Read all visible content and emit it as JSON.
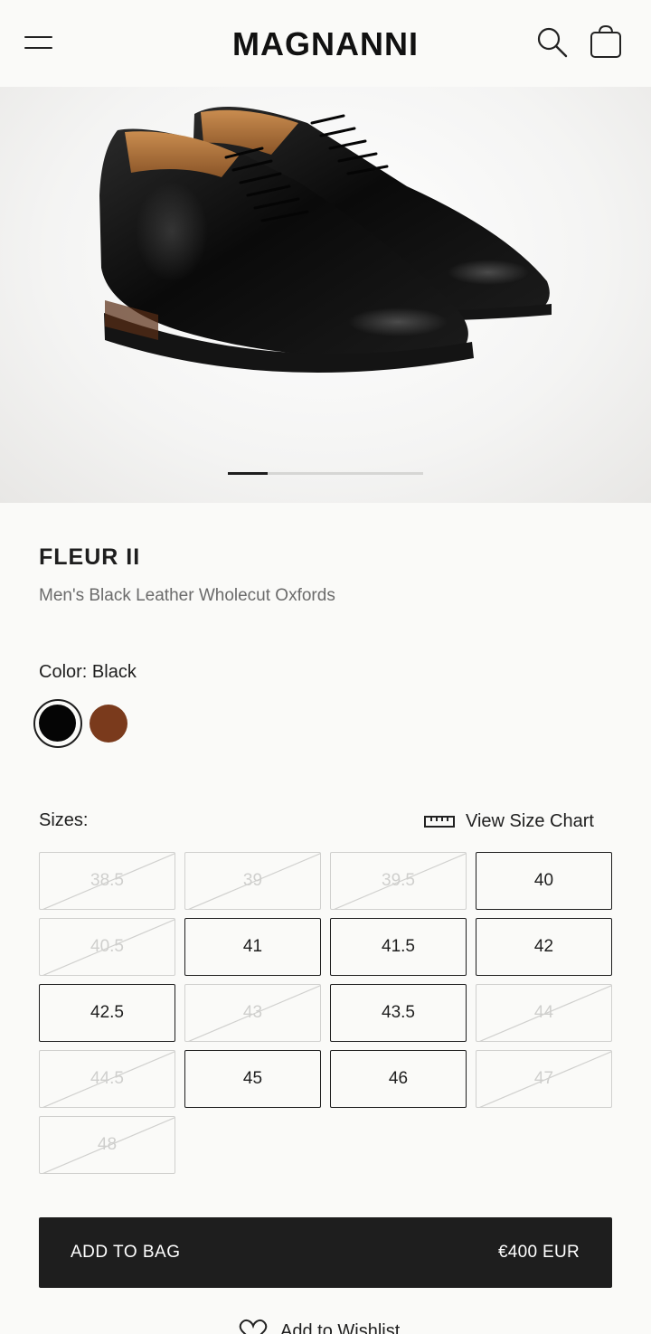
{
  "header": {
    "brand": "MAGNANNI",
    "icons": {
      "menu": "hamburger-menu-icon",
      "search": "search-icon",
      "bag": "shopping-bag-icon"
    }
  },
  "gallery": {
    "image": "black-wholecut-oxford-pair",
    "current_slide": 1,
    "total_slides": 5
  },
  "product": {
    "name": "FLEUR II",
    "description": "Men's Black Leather Wholecut Oxfords"
  },
  "color": {
    "label": "Color: Black",
    "options": [
      {
        "name": "Black",
        "hex": "#050505",
        "selected": true
      },
      {
        "name": "Brown",
        "hex": "#7a3a1c",
        "selected": false
      }
    ]
  },
  "sizes": {
    "label": "Sizes:",
    "chart_link": "View Size Chart",
    "chart_icon": "ruler-icon",
    "options": [
      {
        "size": "38.5",
        "available": false
      },
      {
        "size": "39",
        "available": false
      },
      {
        "size": "39.5",
        "available": false
      },
      {
        "size": "40",
        "available": true
      },
      {
        "size": "40.5",
        "available": false
      },
      {
        "size": "41",
        "available": true
      },
      {
        "size": "41.5",
        "available": true
      },
      {
        "size": "42",
        "available": true
      },
      {
        "size": "42.5",
        "available": true
      },
      {
        "size": "43",
        "available": false
      },
      {
        "size": "43.5",
        "available": true
      },
      {
        "size": "44",
        "available": false
      },
      {
        "size": "44.5",
        "available": false
      },
      {
        "size": "45",
        "available": true
      },
      {
        "size": "46",
        "available": true
      },
      {
        "size": "47",
        "available": false
      },
      {
        "size": "48",
        "available": false
      }
    ]
  },
  "cta": {
    "add_to_bag": "ADD TO BAG",
    "price": "€400 EUR"
  },
  "wishlist": {
    "label": "Add to Wishlist",
    "icon": "heart-icon"
  },
  "colors": {
    "background": "#fafaf8",
    "primary": "#1e1e1e",
    "muted_text": "#6b6b6b",
    "disabled": "#cfcfcd"
  }
}
